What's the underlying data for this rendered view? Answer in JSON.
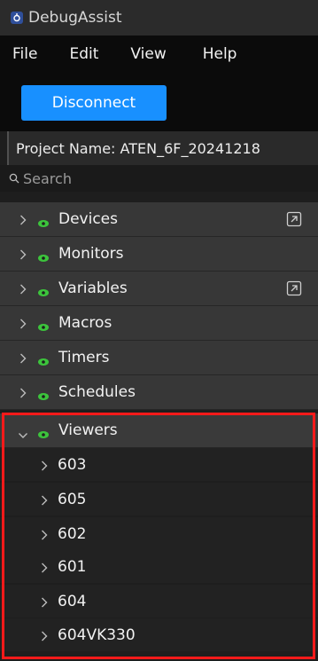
{
  "app": {
    "title": "DebugAssist"
  },
  "menu": [
    "File",
    "Edit",
    "View",
    "Help"
  ],
  "toolbar": {
    "disconnect_label": "Disconnect"
  },
  "project": {
    "label": "Project Name: ATEN_6F_20241218"
  },
  "search": {
    "placeholder": "Search"
  },
  "tree": [
    {
      "label": "Devices",
      "expanded": false,
      "external_icon": true
    },
    {
      "label": "Monitors",
      "expanded": false,
      "external_icon": false
    },
    {
      "label": "Variables",
      "expanded": false,
      "external_icon": true
    },
    {
      "label": "Macros",
      "expanded": false,
      "external_icon": false
    },
    {
      "label": "Timers",
      "expanded": false,
      "external_icon": false
    },
    {
      "label": "Schedules",
      "expanded": false,
      "external_icon": false
    },
    {
      "label": "Viewers",
      "expanded": true,
      "external_icon": false
    }
  ],
  "viewers_children": [
    "603",
    "605",
    "602",
    "601",
    "604",
    "604VK330"
  ],
  "colors": {
    "accent": "#1890ff",
    "eye": "#3cc43c",
    "highlight": "#ff1a1a"
  }
}
